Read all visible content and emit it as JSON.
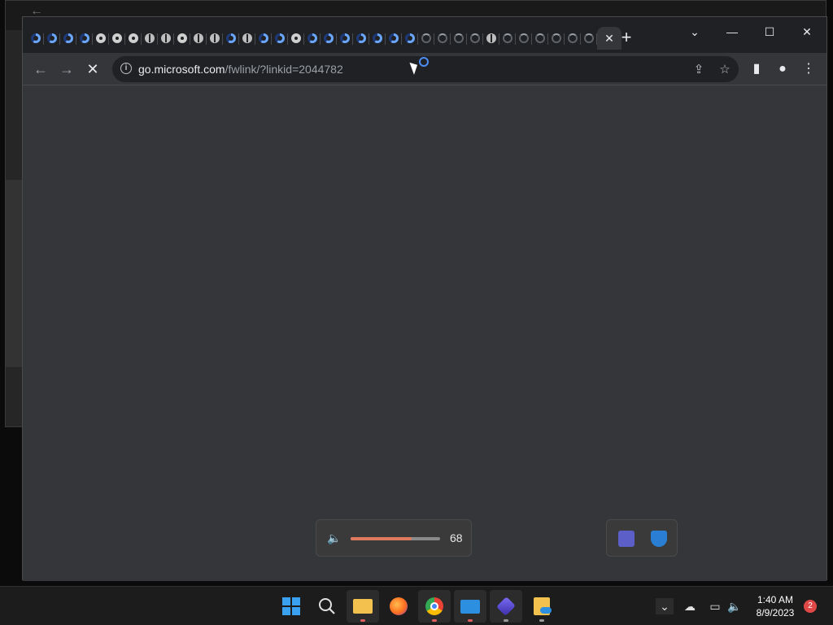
{
  "background_window": {
    "back_glyph": "←"
  },
  "browser": {
    "tabs": [
      {
        "icon": "chrome-favicon-icon"
      },
      {
        "icon": "edge-favicon-icon"
      },
      {
        "icon": "edge-favicon-icon"
      },
      {
        "icon": "edge-favicon-icon"
      },
      {
        "icon": "dots-favicon-icon"
      },
      {
        "icon": "dots-favicon-icon"
      },
      {
        "icon": "dots-favicon-icon"
      },
      {
        "icon": "globe-favicon-icon"
      },
      {
        "icon": "globe-favicon-icon"
      },
      {
        "icon": "dots-favicon-icon"
      },
      {
        "icon": "globe-favicon-icon"
      },
      {
        "icon": "globe-favicon-icon"
      },
      {
        "icon": "edge-favicon-icon"
      },
      {
        "icon": "globe-favicon-icon"
      },
      {
        "icon": "edge-favicon-icon"
      },
      {
        "icon": "edge-favicon-icon"
      },
      {
        "icon": "dots-favicon-icon"
      },
      {
        "icon": "edge-favicon-icon"
      },
      {
        "icon": "edge-favicon-icon"
      },
      {
        "icon": "edge-favicon-icon"
      },
      {
        "icon": "edge-favicon-icon"
      },
      {
        "icon": "edge-favicon-icon"
      },
      {
        "icon": "edge-favicon-icon"
      },
      {
        "icon": "edge-favicon-icon"
      },
      {
        "icon": "loading-spinner-icon"
      },
      {
        "icon": "loading-spinner-icon"
      },
      {
        "icon": "loading-spinner-icon"
      },
      {
        "icon": "loading-spinner-icon"
      },
      {
        "icon": "globe-favicon-icon"
      },
      {
        "icon": "loading-spinner-icon"
      },
      {
        "icon": "loading-spinner-icon"
      },
      {
        "icon": "loading-spinner-icon"
      },
      {
        "icon": "loading-spinner-icon"
      },
      {
        "icon": "loading-spinner-icon"
      },
      {
        "icon": "loading-spinner-icon"
      }
    ],
    "active_tab": {
      "close_glyph": "✕"
    },
    "new_tab_glyph": "+",
    "window_controls": {
      "tab_search": "⌄",
      "minimize": "—",
      "maximize": "☐",
      "close": "✕"
    },
    "toolbar": {
      "back_glyph": "←",
      "forward_glyph": "→",
      "stop_glyph": "✕",
      "info_glyph": "i",
      "url_host": "go.microsoft.com",
      "url_path": "/fwlink/?linkid=2044782",
      "share_glyph": "⇪",
      "bookmark_glyph": "☆",
      "sidepanel_glyph": "▮",
      "profile_glyph": "●",
      "menu_glyph": "⋮"
    }
  },
  "volume_flyout": {
    "value": "68",
    "level_percent": 68,
    "speaker_glyph": "🔈"
  },
  "tray_flyout": {
    "items": [
      "teams-icon",
      "defender-warning-icon"
    ]
  },
  "taskbar": {
    "apps": [
      "start-button",
      "search-button",
      "file-explorer",
      "firefox",
      "chrome",
      "mail",
      "clipchamp",
      "onedrive-folder"
    ],
    "tray": {
      "chevron_glyph": "⌄",
      "onedrive_glyph": "☁",
      "network_glyph": "▭",
      "volume_glyph": "🔈"
    },
    "clock": {
      "time": "1:40 AM",
      "date": "8/9/2023"
    },
    "notification_count": "2"
  },
  "colors": {
    "chrome_bg": "#35363a",
    "tabbar_bg": "#202124",
    "accent_blue": "#4c8df6",
    "volume_fill": "#e07a5f",
    "taskbar_bg": "#1c1c1c",
    "badge_red": "#e04848"
  }
}
